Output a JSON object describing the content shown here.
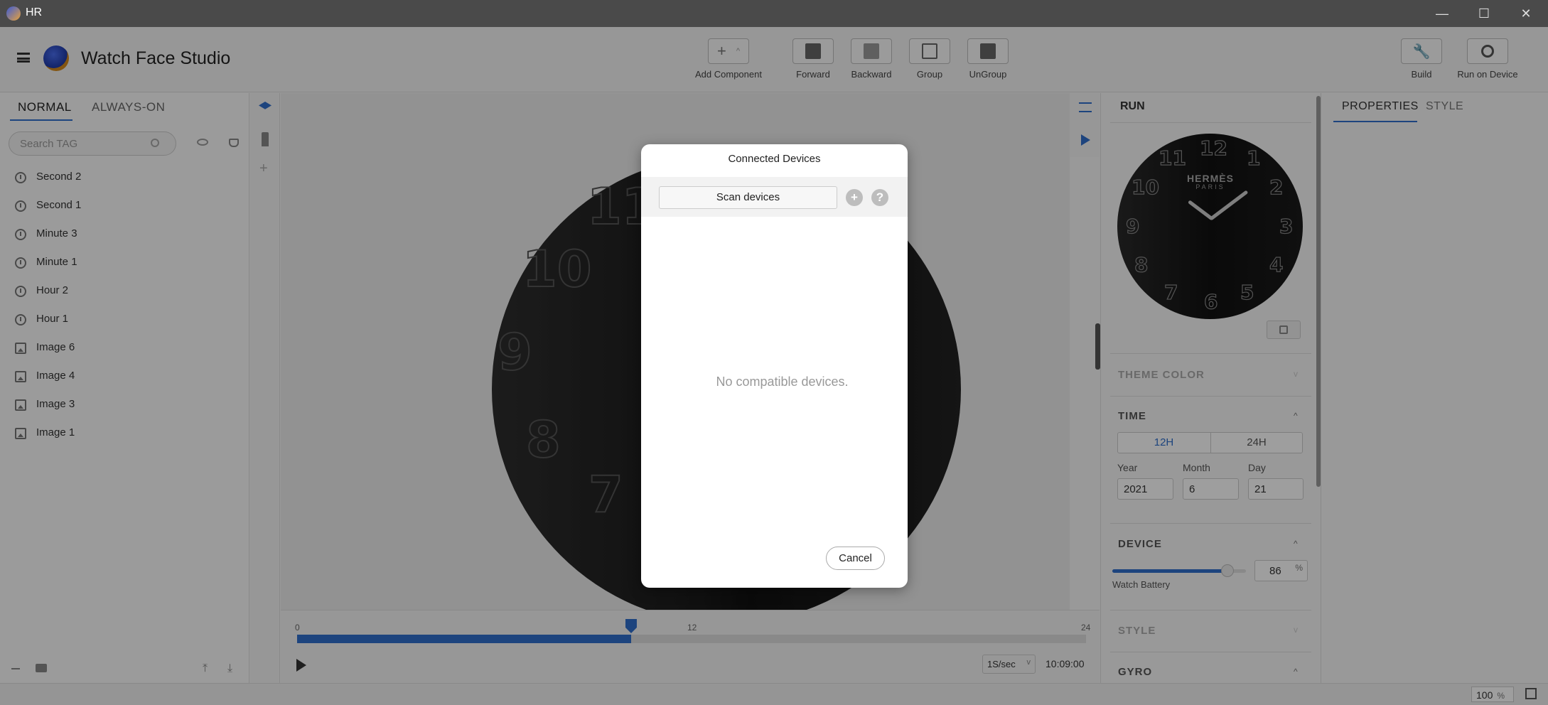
{
  "window": {
    "title": "HR",
    "minimize_icon": "—",
    "maximize_icon": "☐",
    "close_icon": "✕"
  },
  "app": {
    "name": "Watch Face Studio"
  },
  "toolbar": {
    "add_component": "Add Component",
    "forward": "Forward",
    "backward": "Backward",
    "group": "Group",
    "ungroup": "UnGroup",
    "build": "Build",
    "run_on_device": "Run on Device"
  },
  "left": {
    "tabs": [
      "NORMAL",
      "ALWAYS-ON"
    ],
    "search_placeholder": "Search TAG",
    "layers": [
      {
        "label": "Second 2",
        "icon": "clock-icon"
      },
      {
        "label": "Second 1",
        "icon": "clock-icon"
      },
      {
        "label": "Minute 3",
        "icon": "clock-icon"
      },
      {
        "label": "Minute 1",
        "icon": "clock-icon"
      },
      {
        "label": "Hour 2",
        "icon": "clock-icon"
      },
      {
        "label": "Hour 1",
        "icon": "clock-icon"
      },
      {
        "label": "Image 6",
        "icon": "image-icon"
      },
      {
        "label": "Image 4",
        "icon": "image-icon"
      },
      {
        "label": "Image 3",
        "icon": "image-icon"
      },
      {
        "label": "Image 1",
        "icon": "image-icon"
      }
    ]
  },
  "canvas": {
    "numerals": [
      "11",
      "10",
      "9",
      "8",
      "7"
    ]
  },
  "timeline": {
    "start": "0",
    "mid": "12",
    "end": "24",
    "speed": "1S/sec",
    "time": "10:09:00",
    "progress": 0.4234
  },
  "run": {
    "title": "RUN",
    "brand": "HERMÈS",
    "brand_sub": "PARIS",
    "numerals": [
      "12",
      "1",
      "2",
      "3",
      "4",
      "5",
      "6",
      "7",
      "8",
      "9",
      "10",
      "11"
    ],
    "theme_color": "THEME COLOR",
    "time": "TIME",
    "h12": "12H",
    "h24": "24H",
    "year_label": "Year",
    "month_label": "Month",
    "day_label": "Day",
    "year": "2021",
    "month": "6",
    "day": "21",
    "device": "DEVICE",
    "battery": "86",
    "battery_unit": "%",
    "battery_label": "Watch Battery",
    "battery_level": 0.86,
    "style": "STYLE",
    "gyro": "GYRO"
  },
  "props": {
    "tabs": [
      "PROPERTIES",
      "STYLE"
    ]
  },
  "status": {
    "zoom": "100",
    "zoom_unit": "%"
  },
  "dialog": {
    "title": "Connected Devices",
    "scan": "Scan devices",
    "add_icon": "+",
    "help_icon": "?",
    "empty": "No compatible devices.",
    "cancel": "Cancel"
  },
  "colors": {
    "accent": "#2f6fcc",
    "overlay": "rgba(0,0,0,0.38)"
  }
}
